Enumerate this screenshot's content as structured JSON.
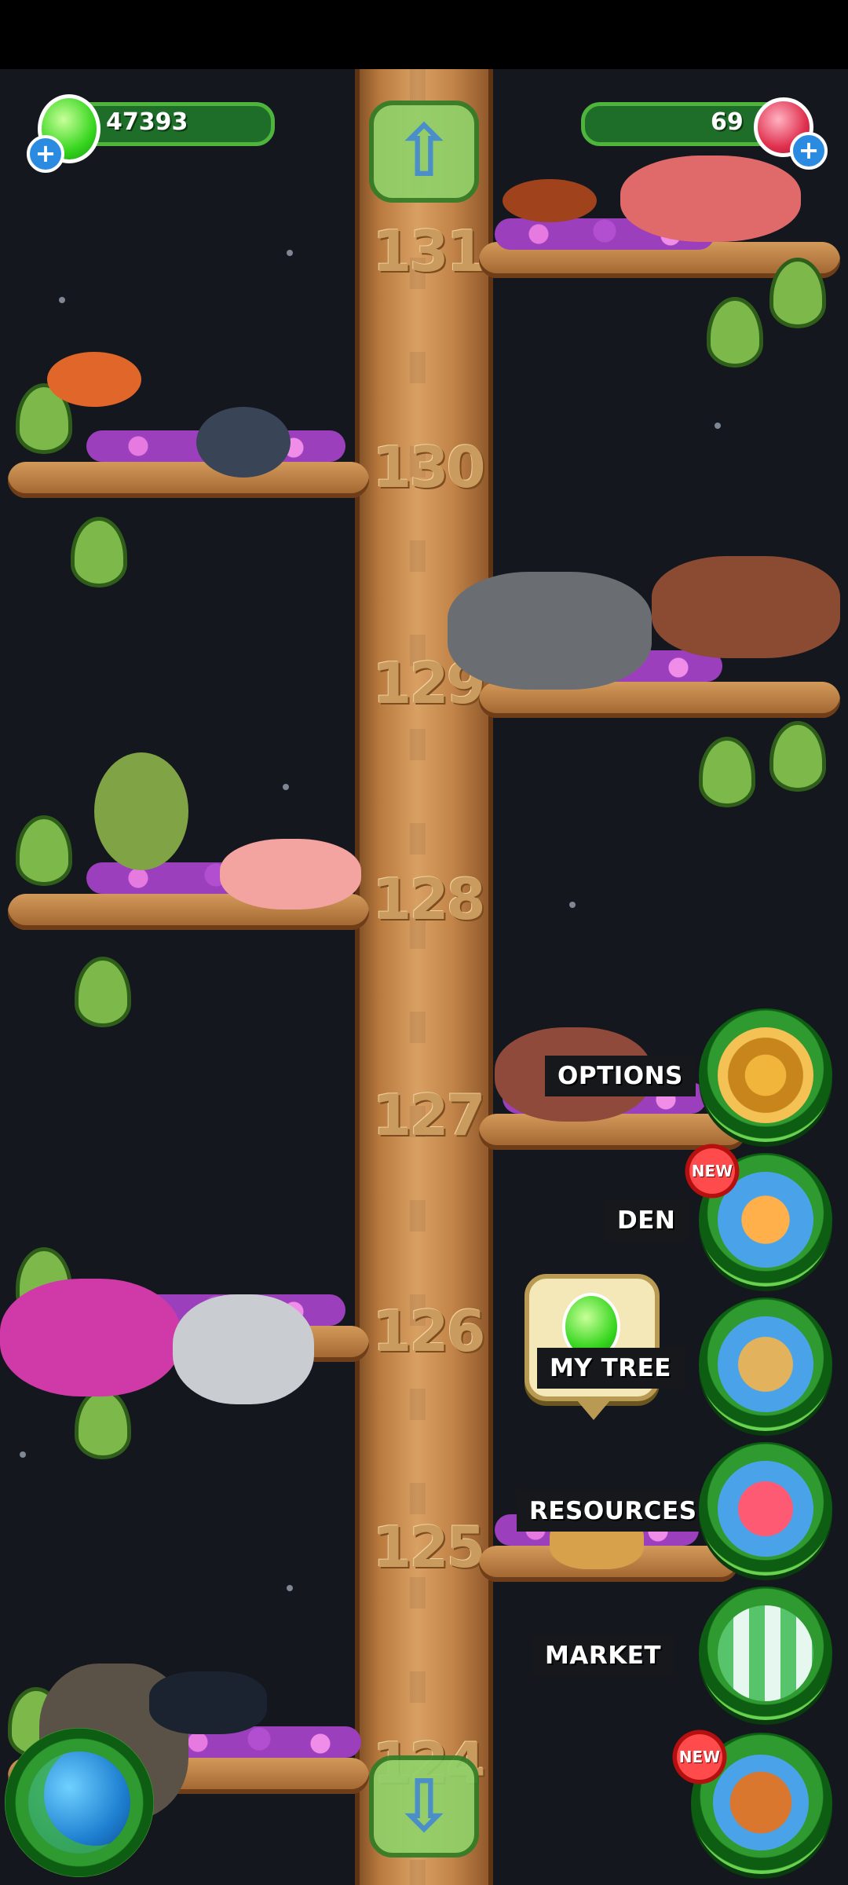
{
  "hud": {
    "green_gems": "47393",
    "red_crystals": "69",
    "green_plus": "+",
    "red_plus": "+"
  },
  "tree_levels": [
    "131",
    "130",
    "129",
    "128",
    "127",
    "126",
    "125",
    "124"
  ],
  "nav": {
    "up_arrow": "⇧",
    "down_arrow": "⇩"
  },
  "menu": {
    "options_label": "OPTIONS",
    "den_label": "DEN",
    "my_tree_label": "MY TREE",
    "resources_label": "RESOURCES",
    "market_label": "MARKET",
    "new_badge_den": "NEW",
    "new_badge_house": "NEW"
  },
  "icons": {
    "options": "gear-icon",
    "den": "den-door-icon",
    "my_tree": "checklist-icon",
    "resources": "crystal-icon",
    "market": "market-stall-icon",
    "house": "house-icon",
    "globe": "globe-icon"
  }
}
